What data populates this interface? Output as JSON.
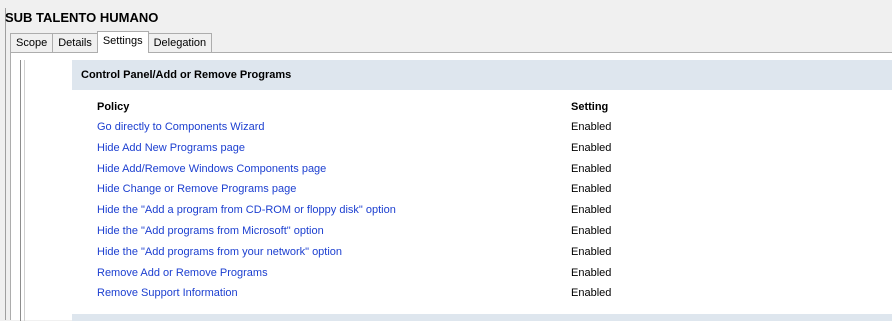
{
  "window": {
    "title": "SUB TALENTO HUMANO"
  },
  "tabs": [
    {
      "label": "Scope",
      "active": false
    },
    {
      "label": "Details",
      "active": false
    },
    {
      "label": "Settings",
      "active": true
    },
    {
      "label": "Delegation",
      "active": false
    }
  ],
  "section": {
    "title": "Control Panel/Add or Remove Programs",
    "columns": {
      "policy": "Policy",
      "setting": "Setting"
    },
    "rows": [
      {
        "policy": "Go directly to Components Wizard",
        "setting": "Enabled"
      },
      {
        "policy": "Hide Add New Programs page",
        "setting": "Enabled"
      },
      {
        "policy": "Hide Add/Remove Windows Components page",
        "setting": "Enabled"
      },
      {
        "policy": "Hide Change or Remove Programs page",
        "setting": "Enabled"
      },
      {
        "policy": "Hide the \"Add a program from CD-ROM or floppy disk\" option",
        "setting": "Enabled"
      },
      {
        "policy": "Hide the \"Add programs from Microsoft\" option",
        "setting": "Enabled"
      },
      {
        "policy": "Hide the \"Add programs from your network\" option",
        "setting": "Enabled"
      },
      {
        "policy": "Remove Add or Remove Programs",
        "setting": "Enabled"
      },
      {
        "policy": "Remove Support Information",
        "setting": "Enabled"
      }
    ]
  },
  "colors": {
    "link": "#1c3fd0",
    "header_bg": "#dee6ee"
  }
}
